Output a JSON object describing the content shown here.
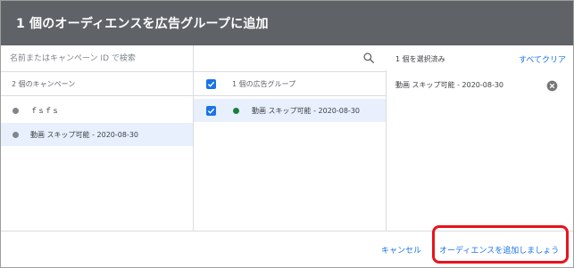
{
  "dialog": {
    "title": "1 個のオーディエンスを広告グループに追加"
  },
  "search": {
    "placeholder": "名前またはキャンペーン ID で検索"
  },
  "campaigns": {
    "header": "2 個のキャンペーン",
    "items": [
      {
        "label": "ｆｓｆｓ",
        "selected": false
      },
      {
        "label": "動画 スキップ可能 - 2020-08-30",
        "selected": true
      }
    ]
  },
  "ad_groups": {
    "header": "1 個の広告グループ",
    "items": [
      {
        "label": "動画 スキップ可能 - 2020-08-30",
        "checked": true,
        "status_color": "#188038"
      }
    ]
  },
  "selection": {
    "count_label": "1 個を選択済み",
    "clear_all": "すべてクリア",
    "items": [
      {
        "label": "動画 スキップ可能 - 2020-08-30"
      }
    ]
  },
  "footer": {
    "cancel": "キャンセル",
    "add": "オーディエンスを追加しましょう"
  },
  "colors": {
    "header_bg": "#5f6368",
    "accent": "#1a73e8",
    "highlight": "#e8141c"
  }
}
